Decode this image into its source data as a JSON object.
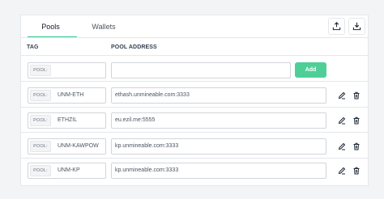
{
  "tabs": {
    "pools": "Pools",
    "wallets": "Wallets"
  },
  "columns": {
    "tag": "TAG",
    "address": "POOL ADDRESS"
  },
  "new_row": {
    "prefix": "POOL:",
    "tag_value": "",
    "address_value": "",
    "add_label": "Add"
  },
  "rows": [
    {
      "prefix": "POOL:",
      "tag": "UNM-ETH",
      "address": "ethash.unmineable.com:3333"
    },
    {
      "prefix": "POOL:",
      "tag": "ETHZIL",
      "address": "eu.ezil.me:5555"
    },
    {
      "prefix": "POOL:",
      "tag": "UNM-KAWPOW",
      "address": "kp.unmineable.com:3333"
    },
    {
      "prefix": "POOL:",
      "tag": "UNM-KP",
      "address": "kp.unmineable.com:3333"
    }
  ],
  "icons": {
    "upload": "upload-icon",
    "download": "download-icon",
    "edit": "edit-icon",
    "delete": "trash-icon"
  },
  "colors": {
    "accent": "#34c993",
    "add_button": "#4fcf98"
  }
}
